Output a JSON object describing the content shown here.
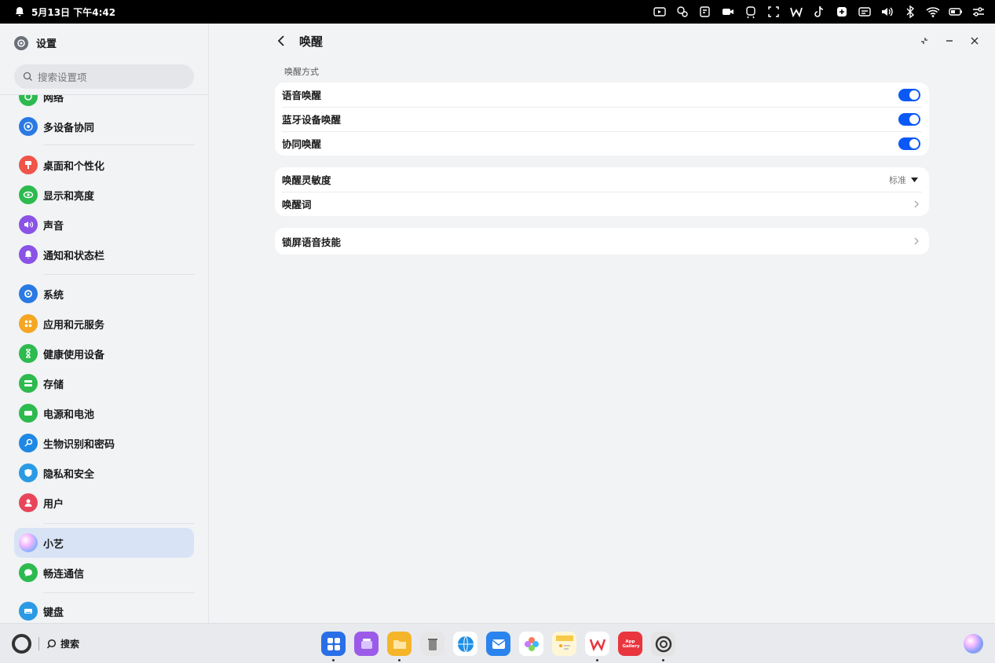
{
  "status_bar": {
    "datetime": "5月13日 下午4:42",
    "icons": [
      "projection-icon",
      "connect-icon",
      "note-icon",
      "video-icon",
      "train-icon",
      "screenshot-icon",
      "wps-icon",
      "tiktok-icon",
      "app-icon",
      "caption-icon",
      "volume-icon",
      "bluetooth-icon",
      "wifi-icon",
      "battery-icon",
      "quick-settings-icon"
    ]
  },
  "sidebar": {
    "title": "设置",
    "search_placeholder": "搜索设置项",
    "items": [
      {
        "label": "网络",
        "color": "#2dba4e"
      },
      {
        "label": "多设备协同",
        "color": "#2a7ae4"
      },
      {
        "label": "桌面和个性化",
        "color": "#f0554a"
      },
      {
        "label": "显示和亮度",
        "color": "#2dba4e"
      },
      {
        "label": "声音",
        "color": "#8a52e6"
      },
      {
        "label": "通知和状态栏",
        "color": "#8a52e6"
      },
      {
        "label": "系统",
        "color": "#2a7ae4"
      },
      {
        "label": "应用和元服务",
        "color": "#f5a623"
      },
      {
        "label": "健康使用设备",
        "color": "#2dba4e"
      },
      {
        "label": "存储",
        "color": "#2dba4e"
      },
      {
        "label": "电源和电池",
        "color": "#2dba4e"
      },
      {
        "label": "生物识别和密码",
        "color": "#1e88e5"
      },
      {
        "label": "隐私和安全",
        "color": "#2a9ae4"
      },
      {
        "label": "用户",
        "color": "#e8455a"
      },
      {
        "label": "小艺",
        "color": "#c9a6ff"
      },
      {
        "label": "畅连通信",
        "color": "#2dba4e"
      },
      {
        "label": "键盘",
        "color": "#2a9ae4"
      }
    ]
  },
  "main": {
    "title": "唤醒",
    "section_label": "唤醒方式",
    "wake_methods": [
      {
        "label": "语音唤醒",
        "enabled": true
      },
      {
        "label": "蓝牙设备唤醒",
        "enabled": true
      },
      {
        "label": "协同唤醒",
        "enabled": true
      }
    ],
    "sensitivity": {
      "label": "唤醒灵敏度",
      "value": "标准"
    },
    "wake_word": {
      "label": "唤醒词"
    },
    "lock_screen": {
      "label": "锁屏语音技能"
    }
  },
  "dock": {
    "search_label": "搜索",
    "apps": [
      {
        "name": "app-center-icon",
        "color": "#2a6fe8"
      },
      {
        "name": "multitask-icon",
        "color": "#9b5be8"
      },
      {
        "name": "files-icon",
        "color": "#f5b52b"
      },
      {
        "name": "trash-icon",
        "color": "#d6d6d6"
      },
      {
        "name": "browser-icon",
        "color": "#1f8fe6"
      },
      {
        "name": "mail-icon",
        "color": "#2b84ee"
      },
      {
        "name": "gallery-icon",
        "color": "#ffffff"
      },
      {
        "name": "notes-icon",
        "color": "#f7c948"
      },
      {
        "name": "wps-icon",
        "color": "#ffffff"
      },
      {
        "name": "appgallery-icon",
        "color": "#e8353e"
      },
      {
        "name": "settings-icon",
        "color": "#e0e0e0"
      }
    ],
    "appgallery_text": "App Gallery"
  }
}
